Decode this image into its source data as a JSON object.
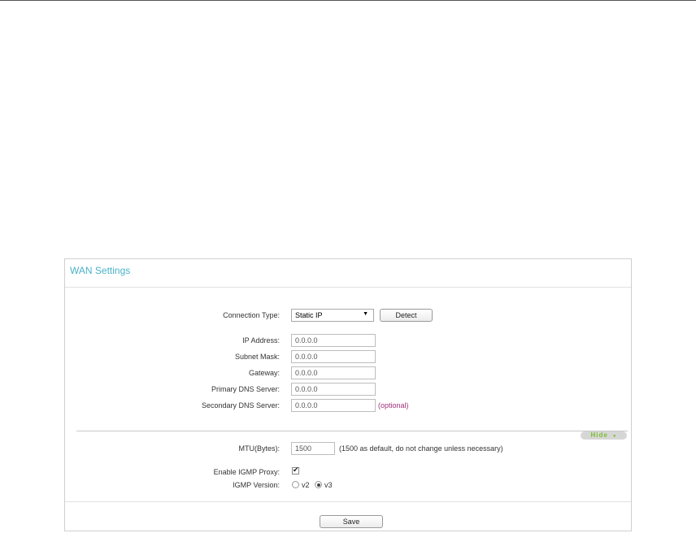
{
  "panel": {
    "title": "WAN Settings"
  },
  "connection": {
    "label": "Connection Type:",
    "selected": "Static IP",
    "detect_label": "Detect"
  },
  "static": {
    "ip_label": "IP Address:",
    "ip_value": "0.0.0.0",
    "mask_label": "Subnet Mask:",
    "mask_value": "0.0.0.0",
    "gateway_label": "Gateway:",
    "gateway_value": "0.0.0.0",
    "dns1_label": "Primary DNS Server:",
    "dns1_value": "0.0.0.0",
    "dns2_label": "Secondary DNS Server:",
    "dns2_value": "0.0.0.0",
    "optional_text": "(optional)"
  },
  "advanced": {
    "hide_label": "Hide",
    "mtu_label": "MTU(Bytes):",
    "mtu_value": "1500",
    "mtu_hint": "(1500 as default, do not change unless necessary)",
    "igmp_proxy_label": "Enable IGMP Proxy:",
    "igmp_proxy_checked": true,
    "igmp_version_label": "IGMP Version:",
    "igmp_v2_label": "v2",
    "igmp_v3_label": "v3",
    "igmp_selected": "v3"
  },
  "footer": {
    "save_label": "Save"
  },
  "colors": {
    "title": "#4ab3c8",
    "optional": "#a0307a",
    "hide": "#7cbf2e"
  }
}
